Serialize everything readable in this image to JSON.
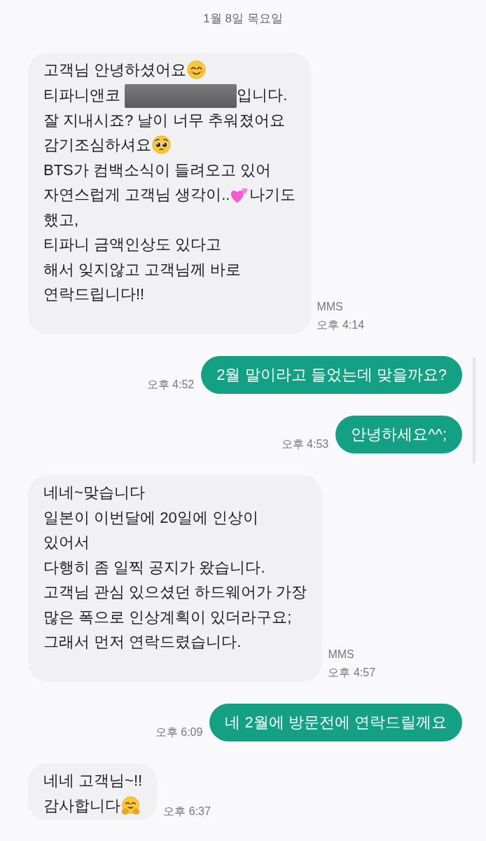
{
  "date_header": "1월 8일 목요일",
  "messages": [
    {
      "kind": "incoming",
      "content": [
        {
          "kind": "text",
          "text": "고객님 안녕하셨어요"
        },
        {
          "kind": "smile"
        },
        {
          "kind": "break"
        },
        {
          "kind": "text",
          "text": "티파니앤코 "
        },
        {
          "kind": "redaction"
        },
        {
          "kind": "text",
          "text": "입니다."
        },
        {
          "kind": "break"
        },
        {
          "kind": "text",
          "text": "잘 지내시죠? 날이 너무 추워졌어요"
        },
        {
          "kind": "break"
        },
        {
          "kind": "text",
          "text": "감기조심하셔요"
        },
        {
          "kind": "pleading"
        },
        {
          "kind": "break"
        },
        {
          "kind": "text",
          "text": "BTS가 컴백소식이 들려오고 있어"
        },
        {
          "kind": "break"
        },
        {
          "kind": "text",
          "text": "자연스럽게 고객님 생각이.."
        },
        {
          "kind": "hearts"
        },
        {
          "kind": "text",
          "text": "나기도"
        },
        {
          "kind": "break"
        },
        {
          "kind": "text",
          "text": "했고,\n티파니 금액인상도 있다고\n해서 잊지않고 고객님께 바로\n연락드립니다!!"
        },
        {
          "kind": "break"
        }
      ],
      "type_label": "MMS",
      "time": "오후 4:14"
    },
    {
      "kind": "outgoing",
      "content": [
        {
          "kind": "text",
          "text": "2월 말이라고 들었는데 맞을까요?"
        }
      ],
      "time": "오후 4:52"
    },
    {
      "kind": "outgoing",
      "content": [
        {
          "kind": "text",
          "text": "안녕하세요^^;"
        }
      ],
      "time": "오후 4:53"
    },
    {
      "kind": "incoming",
      "content": [
        {
          "kind": "text",
          "text": "네네~맞습니다\n일본이 이번달에 20일에 인상이\n있어서\n다행히 좀 일찍 공지가 왔습니다.\n고객님 관심 있으셨던 하드웨어가 가장\n많은 폭으로 인상계획이 있더라구요;\n그래서 먼저 연락드렸습니다."
        },
        {
          "kind": "break"
        }
      ],
      "type_label": "MMS",
      "time": "오후 4:57"
    },
    {
      "kind": "outgoing",
      "content": [
        {
          "kind": "text",
          "text": "네 2월에 방문전에 연락드릴께요"
        }
      ],
      "time": "오후 6:09"
    },
    {
      "kind": "incoming",
      "content": [
        {
          "kind": "text",
          "text": "네네 고객님~!!"
        },
        {
          "kind": "break"
        },
        {
          "kind": "text",
          "text": "감사합니다"
        },
        {
          "kind": "hug"
        }
      ],
      "time": "오후 6:37"
    }
  ]
}
